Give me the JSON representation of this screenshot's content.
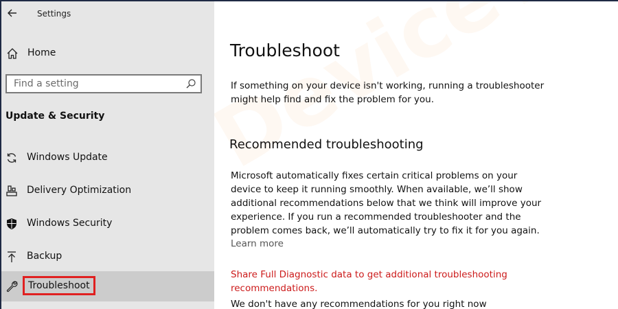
{
  "window": {
    "title": "Settings"
  },
  "sidebar": {
    "home_label": "Home",
    "search": {
      "placeholder": "Find a setting",
      "value": ""
    },
    "section_title": "Update & Security",
    "items": [
      {
        "label": "Windows Update",
        "icon": "sync-icon",
        "active": false
      },
      {
        "label": "Delivery Optimization",
        "icon": "delivery-icon",
        "active": false
      },
      {
        "label": "Windows Security",
        "icon": "shield-icon",
        "active": false
      },
      {
        "label": "Backup",
        "icon": "backup-icon",
        "active": false
      },
      {
        "label": "Troubleshoot",
        "icon": "wrench-icon",
        "active": true
      }
    ]
  },
  "main": {
    "title": "Troubleshoot",
    "intro": "If something on your device isn't working, running a troubleshooter might help find and fix the problem for you.",
    "recommended_title": "Recommended troubleshooting",
    "recommended_text": "Microsoft automatically fixes certain critical problems on your device to keep it running smoothly. When available, we’ll show additional recommendations below that we think will improve your experience. If you run a recommended troubleshooter and the problem comes back, we’ll automatically try to fix it for you again.",
    "learn_more": "Learn more",
    "diagnostic_link": "Share Full Diagnostic data to get additional troubleshooting recommendations.",
    "no_recommendations": "We don't have any recommendations for you right now"
  },
  "watermark": "DeviceTricks",
  "colors": {
    "sidebar_bg": "#e6e6e6",
    "active_item_bg": "#cccccc",
    "highlight_box": "#e02020",
    "link_red": "#cc1a1a"
  }
}
